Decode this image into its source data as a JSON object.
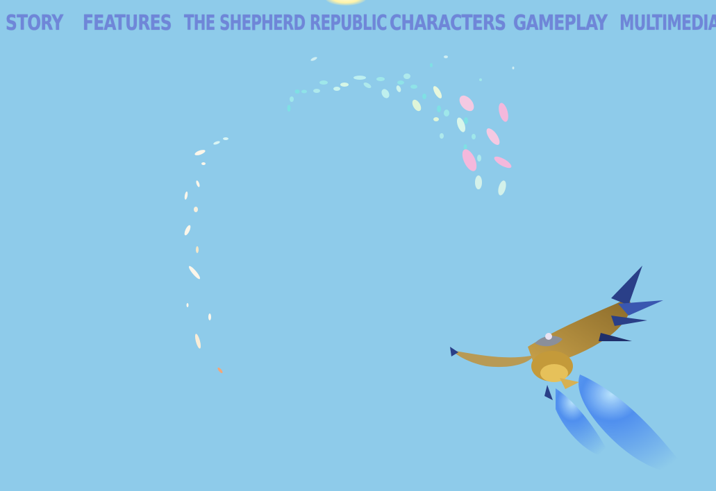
{
  "nav": {
    "items": [
      {
        "label": "STORY"
      },
      {
        "label": "FEATURES"
      },
      {
        "label": "THE SHEPHERD REPUBLIC"
      },
      {
        "label": "CHARACTERS"
      },
      {
        "label": "GAMEPLAY"
      },
      {
        "label": "MULTIMEDIA"
      }
    ]
  },
  "colors": {
    "sky": "#8ecbea",
    "nav_text": "#6f86d8",
    "petal_cyan": "#7fe0e4",
    "petal_pink": "#f4b8dc",
    "petal_white": "#fbf6ea",
    "thruster_blue": "#3d7df0"
  },
  "scene": {
    "hero": "dragon-rider",
    "effect": "petal-trail"
  }
}
